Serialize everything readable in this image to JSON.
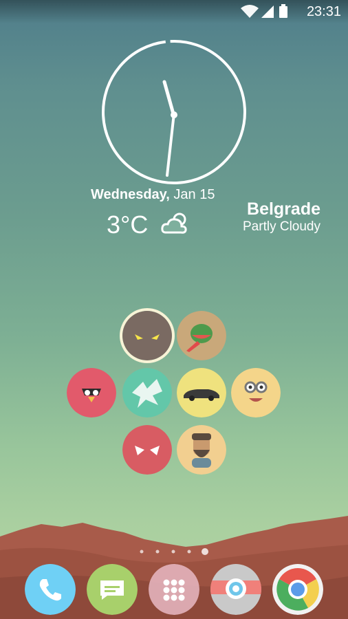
{
  "status_bar": {
    "time": "23:31",
    "icons": [
      "wifi-icon",
      "cellular-signal-icon",
      "battery-icon"
    ]
  },
  "clock_widget": {
    "hour_hand": "11:30",
    "minute_hand": "31"
  },
  "date_widget": {
    "day": "Wednesday,",
    "date": "Jan 15"
  },
  "weather_widget": {
    "temperature": "3°C",
    "icon": "partly-cloudy-icon",
    "city": "Belgrade",
    "condition": "Partly Cloudy"
  },
  "home_grid": {
    "apps": [
      {
        "name": "app-masked-face",
        "icon": "mask-face-icon",
        "color": "#7a6a62"
      },
      {
        "name": "app-fruit-ninja",
        "icon": "watermelon-icon",
        "color": "#c9a87a"
      },
      {
        "name": "app-angry-birds",
        "icon": "angry-bird-icon",
        "color": "#e25a6b"
      },
      {
        "name": "app-splash",
        "icon": "splash-icon",
        "color": "#63c7a9"
      },
      {
        "name": "app-racing",
        "icon": "car-icon",
        "color": "#efe27e"
      },
      {
        "name": "app-minion",
        "icon": "minion-icon",
        "color": "#f4d58a"
      },
      {
        "name": "app-spiderman",
        "icon": "spider-mask-icon",
        "color": "#d85c63"
      },
      {
        "name": "app-bearded-hero",
        "icon": "bearded-face-icon",
        "color": "#f2cf90"
      }
    ]
  },
  "page_indicator": {
    "count": 5,
    "active": 4
  },
  "dock": {
    "apps": [
      {
        "name": "phone",
        "icon": "phone-icon",
        "color": "#6fd0f5"
      },
      {
        "name": "messaging",
        "icon": "message-icon",
        "color": "#a8d06b"
      },
      {
        "name": "app-drawer",
        "icon": "grid-dots-icon",
        "color": "#e9b8c4"
      },
      {
        "name": "camera",
        "icon": "camera-icon",
        "color": "#c9c9c9"
      },
      {
        "name": "chrome",
        "icon": "chrome-icon",
        "color": "#f2f2f2"
      }
    ]
  }
}
